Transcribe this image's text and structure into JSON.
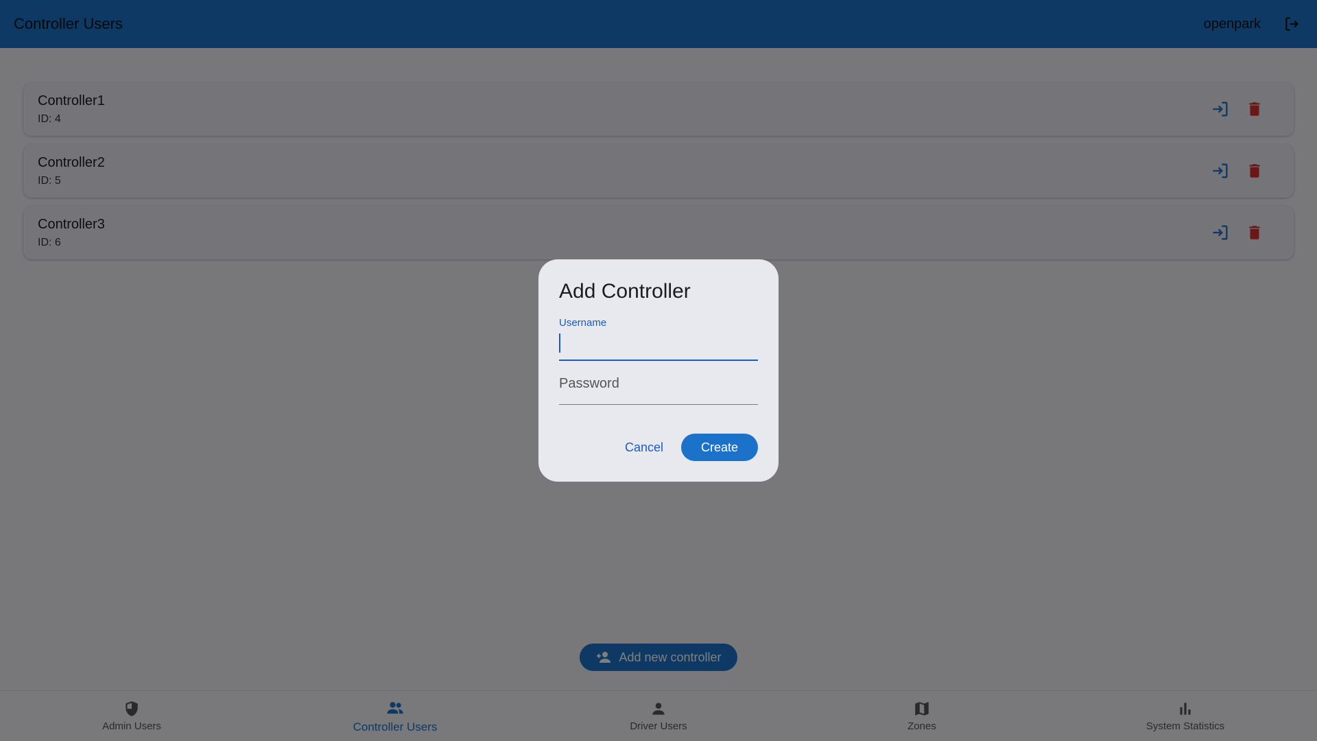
{
  "app_bar": {
    "title": "Controller Users",
    "username": "openpark",
    "logout_icon": "logout-icon"
  },
  "controllers": [
    {
      "name": "Controller1",
      "id_text": "ID: 4"
    },
    {
      "name": "Controller2",
      "id_text": "ID: 5"
    },
    {
      "name": "Controller3",
      "id_text": "ID: 6"
    }
  ],
  "card_actions": {
    "login_icon": "login-icon",
    "delete_icon": "delete-icon"
  },
  "fab": {
    "label": "Add new controller",
    "icon": "person-add-icon"
  },
  "bottom_nav": [
    {
      "label": "Admin Users",
      "icon": "shield-icon",
      "active": false
    },
    {
      "label": "Controller Users",
      "icon": "group-icon",
      "active": true
    },
    {
      "label": "Driver Users",
      "icon": "person-icon",
      "active": false
    },
    {
      "label": "Zones",
      "icon": "map-icon",
      "active": false
    },
    {
      "label": "System Statistics",
      "icon": "bar-chart-icon",
      "active": false
    }
  ],
  "dialog": {
    "title": "Add Controller",
    "username_label": "Username",
    "username_value": "",
    "password_placeholder": "Password",
    "cancel_label": "Cancel",
    "create_label": "Create"
  },
  "colors": {
    "primary": "#1b72c8",
    "delete": "#d32f2f",
    "surface": "#f1f0f7"
  }
}
